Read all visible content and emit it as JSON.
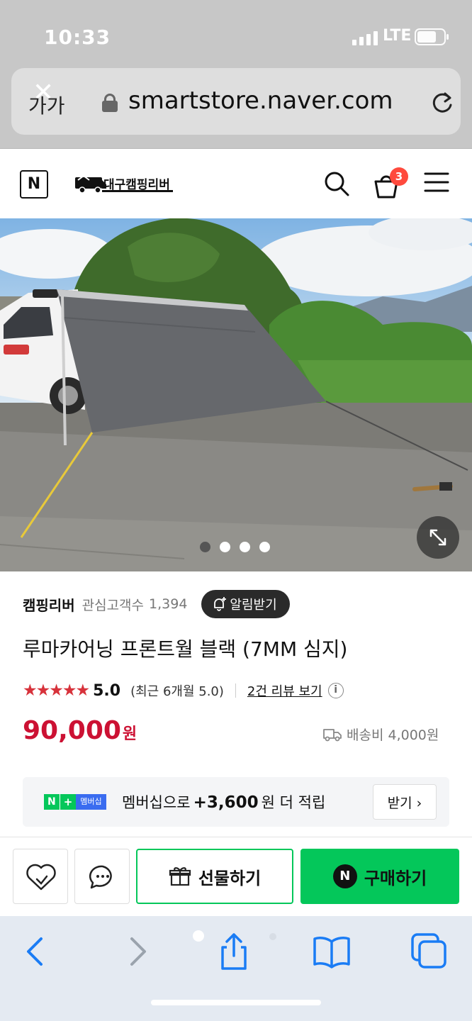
{
  "status_bar": {
    "time": "10:33",
    "network": "LTE"
  },
  "browser": {
    "text_size": "가가",
    "url": "smartstore.naver.com"
  },
  "header": {
    "naver_logo": "N",
    "store_logo_text": "대구캠핑리버",
    "cart_count": "3"
  },
  "gallery": {
    "total_images": 4,
    "active_index": 0
  },
  "seller": {
    "name": "캠핑리버",
    "fans_label": "관심고객수",
    "fans_count": "1,394",
    "alarm_label": "알림받기"
  },
  "product": {
    "title": "루마카어닝 프론트월 블랙 (7MM 심지)",
    "stars": "★★★★★",
    "rating": "5.0",
    "recent_rating": "(최근 6개월 5.0)",
    "review_link": "2건 리뷰 보기",
    "info": "i",
    "price": "90,000",
    "currency": "원",
    "shipping": "배송비 4,000원"
  },
  "membership": {
    "badge_n": "N",
    "badge_plus": "+",
    "badge_label": "멤버십",
    "text_before": "멤버십으로",
    "points": "+3,600",
    "text_after": "원 더 적립",
    "receive_label": "받기 ›"
  },
  "purchase_bar": {
    "gift_label": "선물하기",
    "buy_label": "구매하기",
    "buy_logo": "N"
  },
  "colors": {
    "naver_green": "#04c75a",
    "price_red": "#cc1133",
    "star_red": "#d7323b",
    "safari_blue": "#1a7cf5"
  }
}
